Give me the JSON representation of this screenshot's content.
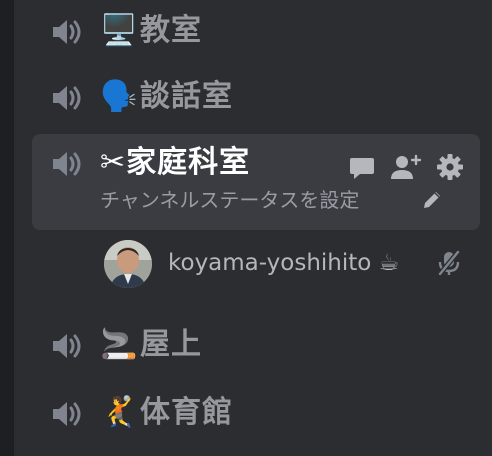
{
  "channels": [
    {
      "emoji": "🖥️",
      "name": "教室"
    },
    {
      "emoji": "🗣️",
      "name": "談話室"
    },
    {
      "emoji": "✂️",
      "name": "✂家庭科室",
      "status": "チャンネルステータスを設定"
    },
    {
      "emoji": "🚬",
      "name": "屋上"
    },
    {
      "emoji": "🤾",
      "name": "体育館"
    }
  ],
  "voice_member": {
    "username": "koyama-yoshihito ☕"
  },
  "icons": {
    "speaker": "speaker-icon",
    "chat": "chat-bubble-icon",
    "invite": "add-member-icon",
    "settings": "gear-icon",
    "pencil": "pencil-icon",
    "mute": "mic-muted-icon"
  },
  "colors": {
    "background": "#2b2d31",
    "active_row": "#3a3c42",
    "muted_text": "#96989d",
    "active_text": "#ffffff"
  }
}
